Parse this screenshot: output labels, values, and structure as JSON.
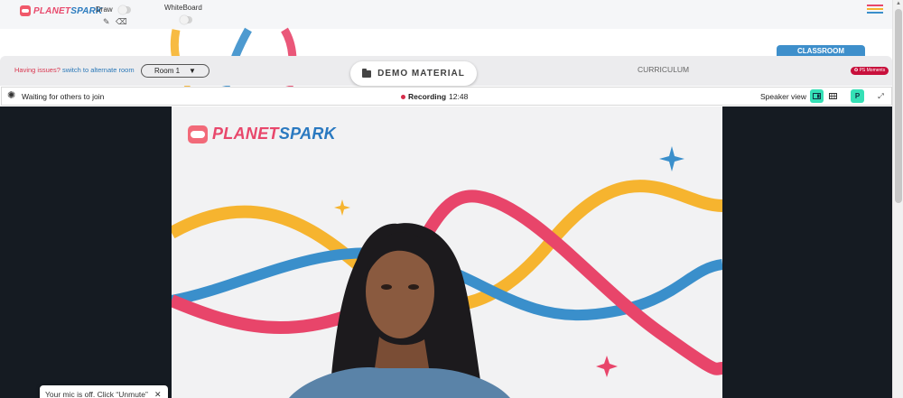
{
  "brand": {
    "part1": "PLANET",
    "part2": "SPARK"
  },
  "toolbar": {
    "draw_label": "Draw",
    "pencil_icon": "✎",
    "eraser_icon": "⌫",
    "whiteboard_label": "WhiteBoard"
  },
  "header": {
    "issues_text": "Having issues?",
    "alternate_link": "switch to alternate room",
    "room_select": "Room 1",
    "room_caret": "▼",
    "demo_material": "DEMO MATERIAL",
    "curriculum": "CURRICULUM",
    "classroom": "CLASSROOM",
    "moments": "✪ PS Moments"
  },
  "meeting": {
    "waiting": "Waiting for others to join",
    "recording_label": "Recording",
    "recording_time": "12:48",
    "speaker_view": "Speaker view",
    "participant_initial": "P",
    "expand_icon": "⤢",
    "settings_icon": "✺"
  },
  "toast": {
    "text": "Your mic is off. Click “Unmute”",
    "close": "✕"
  },
  "colors": {
    "accent_blue": "#3e8fcb",
    "brand_pink": "#e8476b",
    "wave_red": "#e8456a",
    "wave_yellow": "#f6b42f",
    "wave_blue": "#3a8fcb",
    "recording": "#d62c4a",
    "teal_btn": "#35e0b6"
  }
}
